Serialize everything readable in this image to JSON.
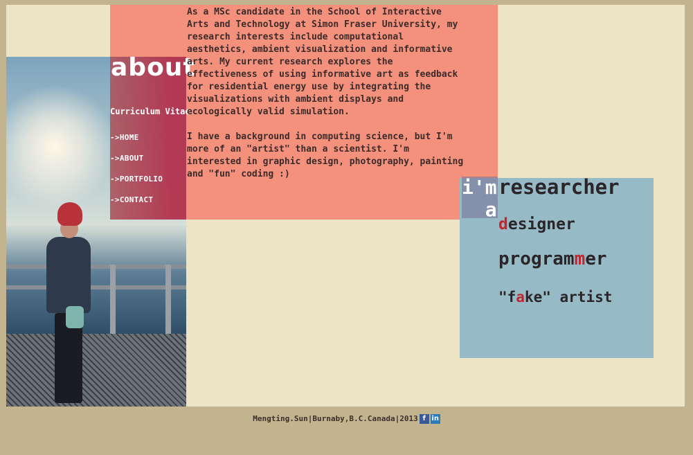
{
  "nav": {
    "title": "about",
    "cv_label": "Curriculum Vitae",
    "items": [
      {
        "label": "->HOME"
      },
      {
        "label": "->ABOUT"
      },
      {
        "label": "->PORTFOLIO"
      },
      {
        "label": "->CONTACT"
      }
    ]
  },
  "intro": {
    "paragraph1": "As a MSc candidate in the School of Interactive Arts and Technology at Simon Fraser University, my research interests include computational aesthetics, ambient visualization and informative arts. My current research explores the effectiveness of using informative art as feedback for residential energy use by integrating the visualizations with ambient displays and ecologically valid simulation.",
    "paragraph2": "I have a background in computing science, but I'm more of an \"artist\" than a scientist. I'm interested in graphic design, photography, painting and \"fun\" coding :)"
  },
  "roles": {
    "prefix_line1": "i'm",
    "prefix_line2": "a",
    "researcher": "researcher",
    "designer_hl": "d",
    "designer_rest": "esigner",
    "programmer_pre": "program",
    "programmer_hl": "m",
    "programmer_post": "er",
    "artist_pre": "\"f",
    "artist_hl": "a",
    "artist_post": "ke\" artist"
  },
  "footer": {
    "text": "Mengting.Sun|Burnaby,B.C.Canada|2013",
    "facebook_icon": "facebook-icon",
    "linkedin_icon": "linkedin-icon"
  },
  "colors": {
    "page_bg": "#c2b48f",
    "panel_bg": "#ede3c5",
    "pink": "#f5826e",
    "blue": "#96bac6",
    "highlight": "#c4242d"
  }
}
